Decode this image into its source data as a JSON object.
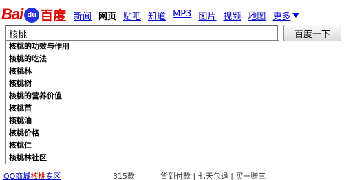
{
  "logo": {
    "bai": "Bai",
    "du": "du",
    "cn": "百度"
  },
  "nav": {
    "items": [
      {
        "label": "新闻",
        "current": false
      },
      {
        "label": "网页",
        "current": true
      },
      {
        "label": "贴吧",
        "current": false
      },
      {
        "label": "知道",
        "current": false
      },
      {
        "label": "MP3",
        "current": false
      },
      {
        "label": "图片",
        "current": false
      },
      {
        "label": "视频",
        "current": false
      },
      {
        "label": "地图",
        "current": false
      }
    ],
    "more_label": "更多"
  },
  "search": {
    "value": "核桃",
    "button_label": "百度一下"
  },
  "suggestions": [
    "核桃的功效与作用",
    "核桃的吃法",
    "核桃林",
    "核桃树",
    "核桃的营养价值",
    "核桃苗",
    "核桃油",
    "核桃价格",
    "核桃仁",
    "核桃林社区"
  ],
  "bottom_row": {
    "qq_prefix": "QQ商城",
    "qq_highlight": "核桃",
    "qq_suffix": "专区",
    "count": "315款",
    "links": "货到付款 | 七天包退 | 买一赠三"
  },
  "colors": {
    "link": "#0000cc",
    "brand_red": "#e10602",
    "brand_blue": "#2932e1"
  }
}
